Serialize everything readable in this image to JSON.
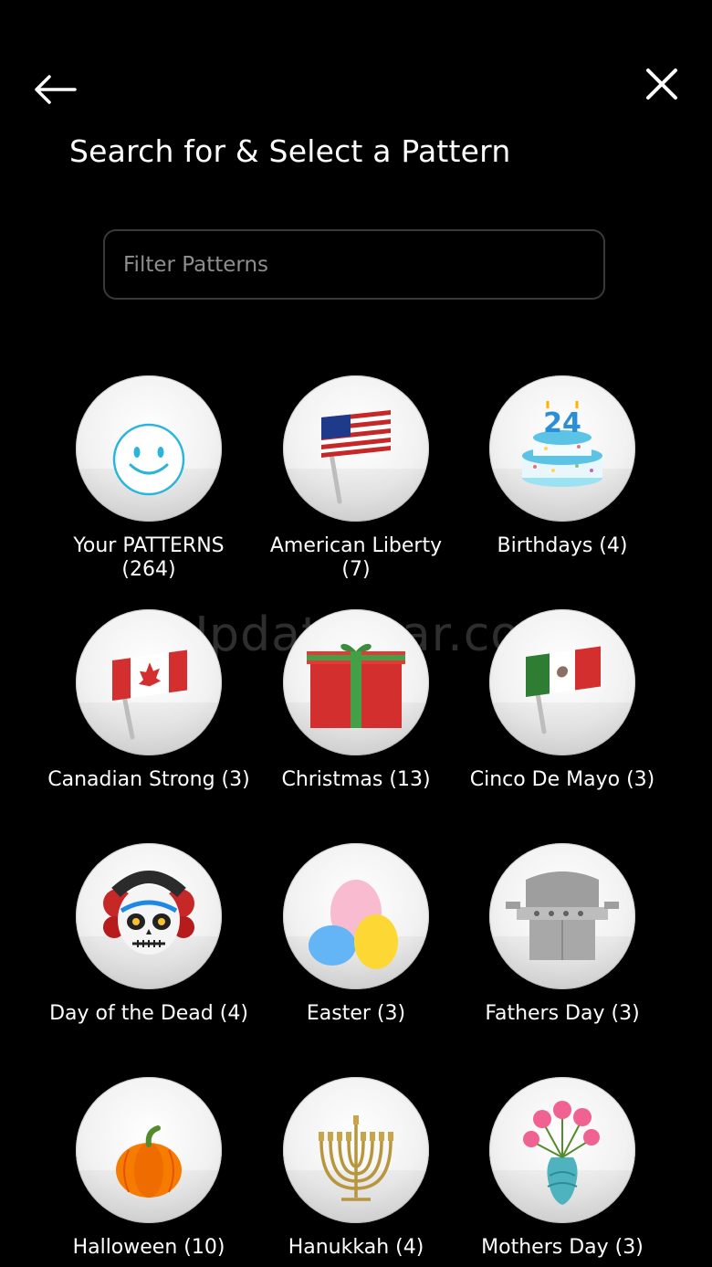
{
  "header": {
    "back_icon": "arrow-left-icon",
    "close_icon": "close-icon",
    "title": "Search for & Select a Pattern"
  },
  "search": {
    "placeholder": "Filter Patterns",
    "value": ""
  },
  "patterns": [
    {
      "label": "Your PATTERNS (264)",
      "icon": "smiley-face-icon"
    },
    {
      "label": "American Liberty (7)",
      "icon": "american-flag-icon"
    },
    {
      "label": "Birthdays (4)",
      "icon": "birthday-cake-icon"
    },
    {
      "label": "Canadian Strong (3)",
      "icon": "canadian-flag-icon"
    },
    {
      "label": "Christmas (13)",
      "icon": "gift-box-icon"
    },
    {
      "label": "Cinco De Mayo (3)",
      "icon": "mexican-flag-icon"
    },
    {
      "label": "Day of the Dead (4)",
      "icon": "sugar-skull-icon"
    },
    {
      "label": "Easter (3)",
      "icon": "easter-eggs-icon"
    },
    {
      "label": "Fathers Day (3)",
      "icon": "grill-icon"
    },
    {
      "label": "Halloween (10)",
      "icon": "pumpkin-icon"
    },
    {
      "label": "Hanukkah (4)",
      "icon": "menorah-icon"
    },
    {
      "label": "Mothers Day (3)",
      "icon": "flower-vase-icon"
    }
  ],
  "watermark": "UpdateStar.com",
  "colors": {
    "background": "#000000",
    "text": "#ffffff",
    "input_border": "#3a3a3a",
    "placeholder": "#8e8e8e"
  }
}
